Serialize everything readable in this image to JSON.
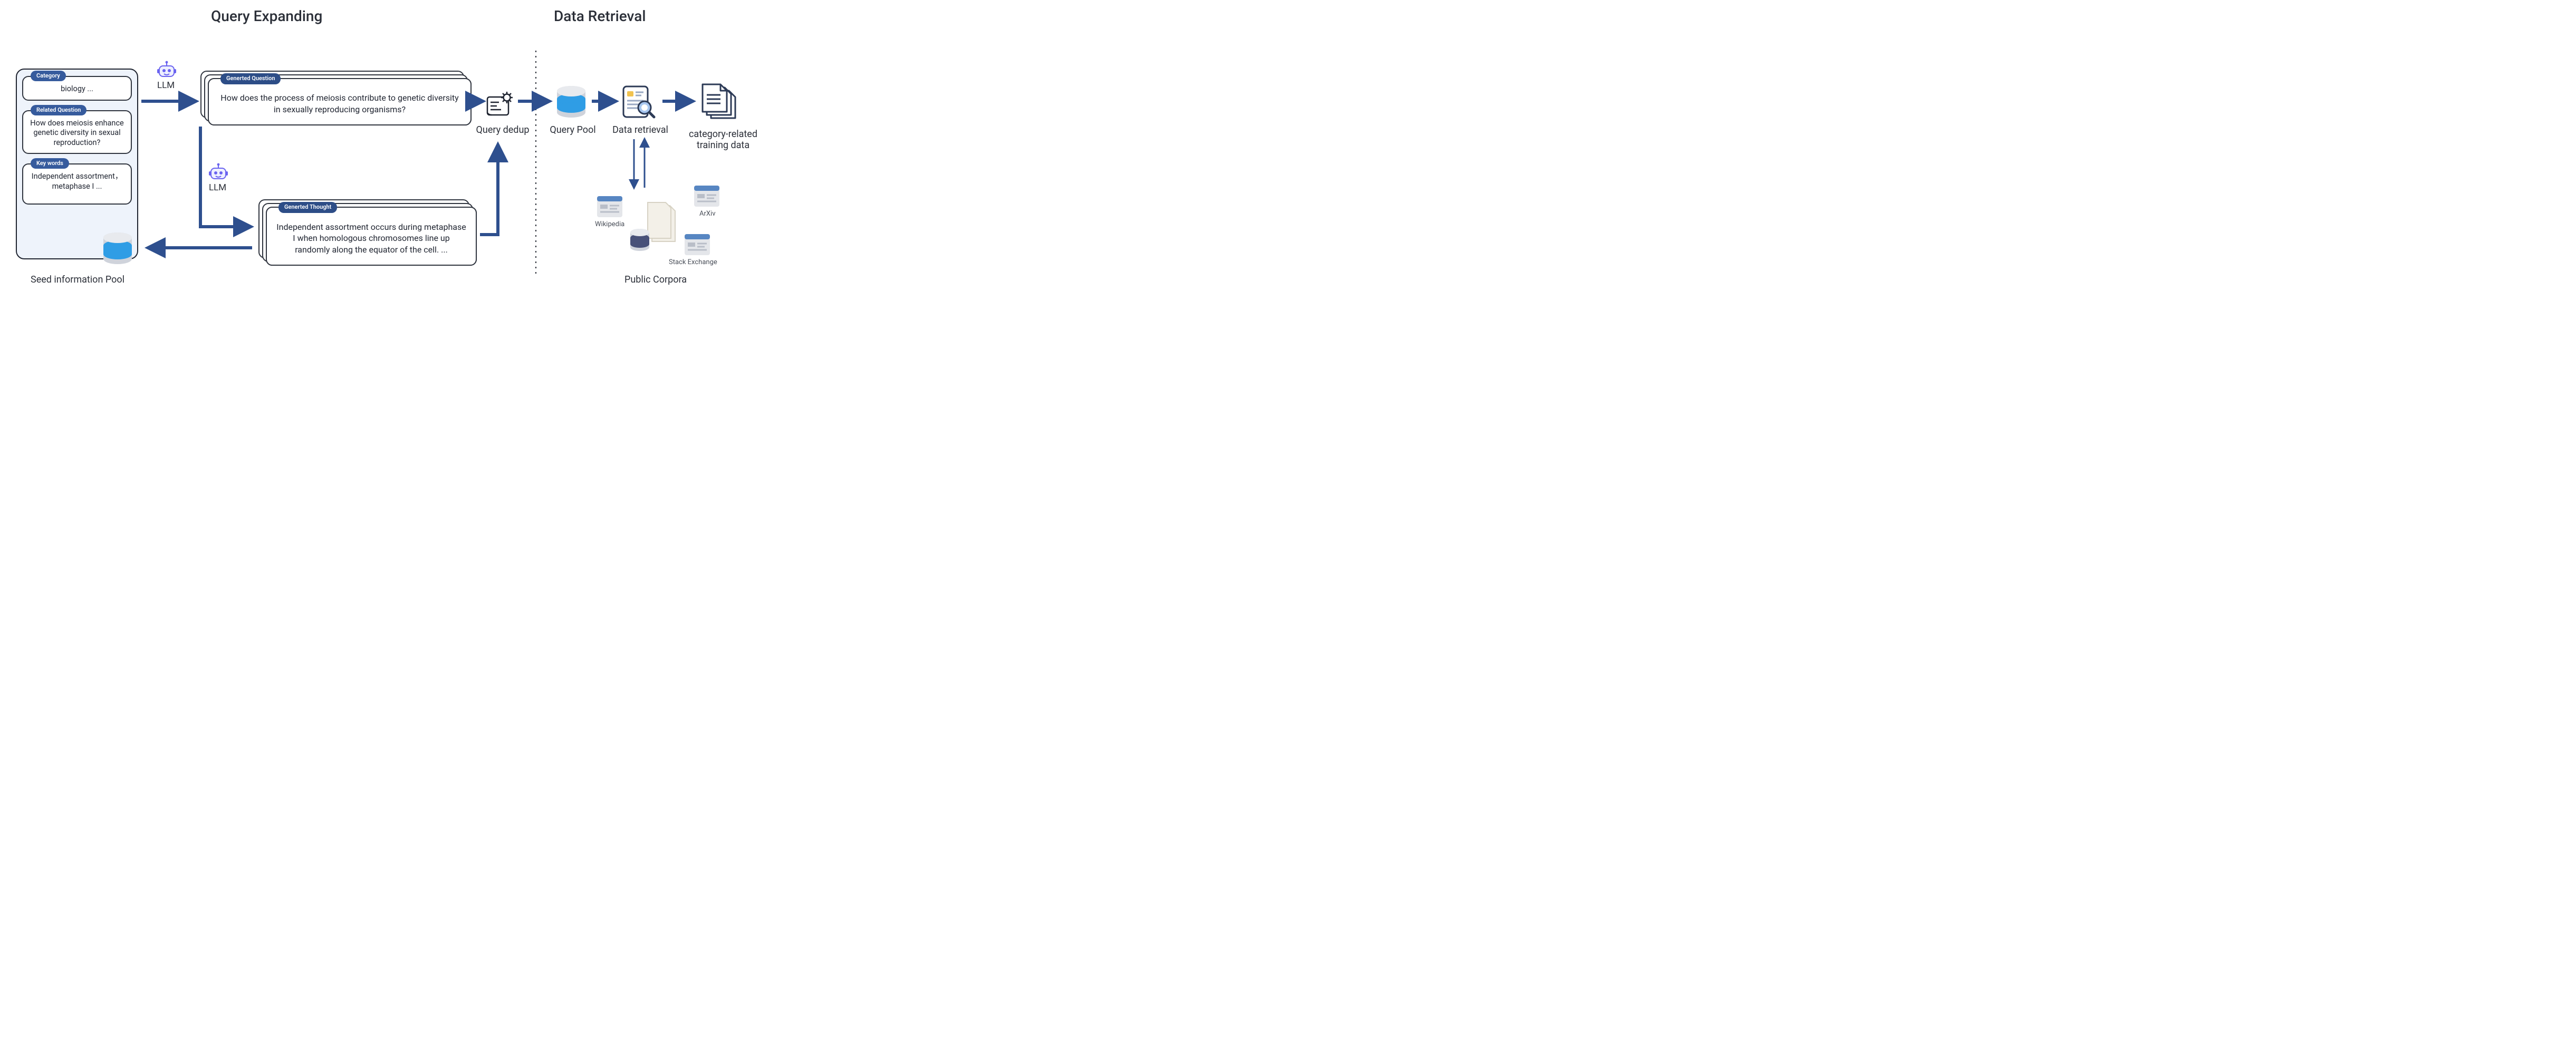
{
  "titles": {
    "query_expanding": "Query Expanding",
    "data_retrieval": "Data Retrieval"
  },
  "seed_panel": {
    "caption": "Seed information Pool",
    "items": [
      {
        "label": "Category",
        "text": "biology ..."
      },
      {
        "label": "Related Question",
        "text": "How does meiosis enhance genetic diversity in sexual reproduction?"
      },
      {
        "label": "Key words",
        "text": "Independent assortment，metaphase I ..."
      }
    ]
  },
  "llm_label": "LLM",
  "generated_question": {
    "label": "Generted Question",
    "text": "How does the process of meiosis contribute to genetic diversity in sexually reproducing organisms?"
  },
  "generated_thought": {
    "label": "Generted Thought",
    "text": "Independent assortment occurs during metaphase I when homologous chromosomes line up randomly along the equator of the cell. ..."
  },
  "captions": {
    "query_dedup": "Query dedup",
    "query_pool": "Query Pool",
    "data_retrieval_node": "Data retrieval",
    "output": "category-related\ntraining data",
    "public_corpora": "Public Corpora"
  },
  "corpora": {
    "wikipedia": "Wikipedia",
    "arxiv": "ArXiv",
    "stack_exchange": "Stack Exchange"
  },
  "icons": {
    "robot": "robot-icon",
    "dedup": "blueprint-gear-icon",
    "db": "database-icon",
    "retrieval": "document-magnifier-icon",
    "docs": "documents-icon",
    "browser": "browser-window-icon",
    "papers": "paper-stack-icon"
  },
  "colors": {
    "arrow": "#2e4f8e",
    "pill": "#365b9d",
    "panel_bg": "#eef3fb",
    "db_light": "#6ab4ea",
    "db_dark": "#485179"
  }
}
